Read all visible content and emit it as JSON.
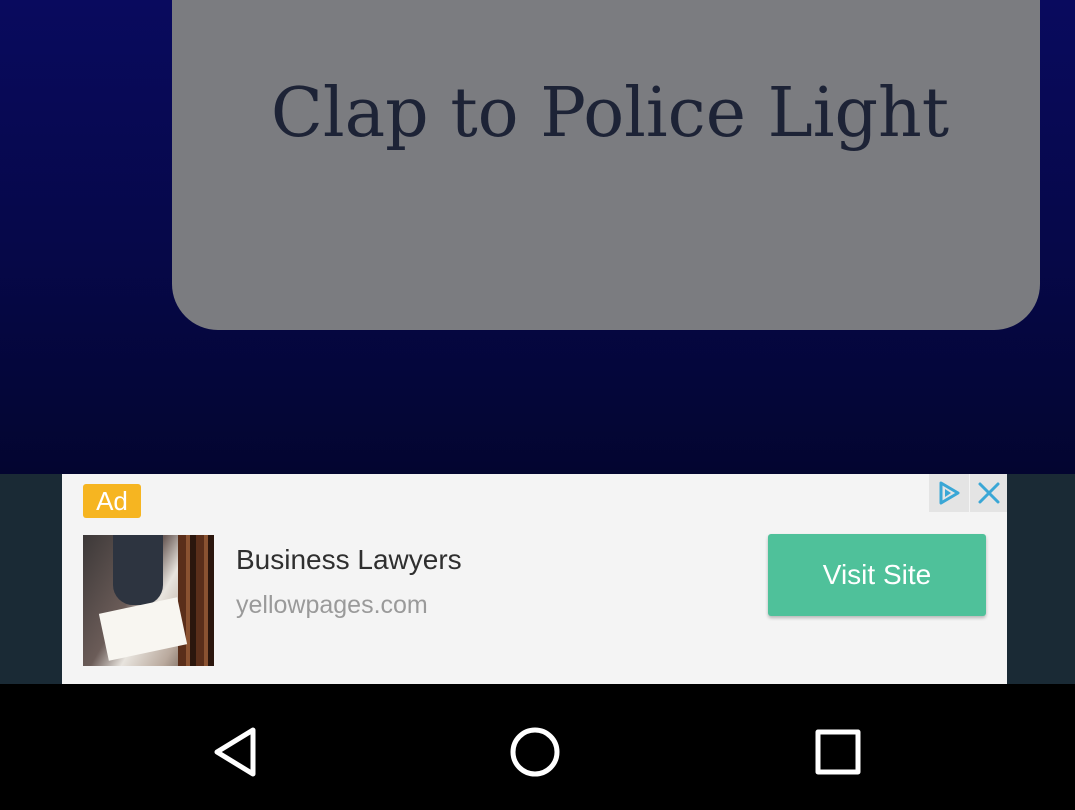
{
  "app": {
    "title": "Clap to Police Light"
  },
  "ad": {
    "badge": "Ad",
    "headline": "Business Lawyers",
    "url": "yellowpages.com",
    "cta_label": "Visit Site",
    "adchoices_icon": "adchoices-icon",
    "close_icon": "close-icon",
    "colors": {
      "badge": "#f6b521",
      "cta": "#4fc19a"
    }
  },
  "navbar": {
    "back_icon": "back-triangle-icon",
    "home_icon": "home-circle-icon",
    "recents_icon": "recents-square-icon"
  }
}
